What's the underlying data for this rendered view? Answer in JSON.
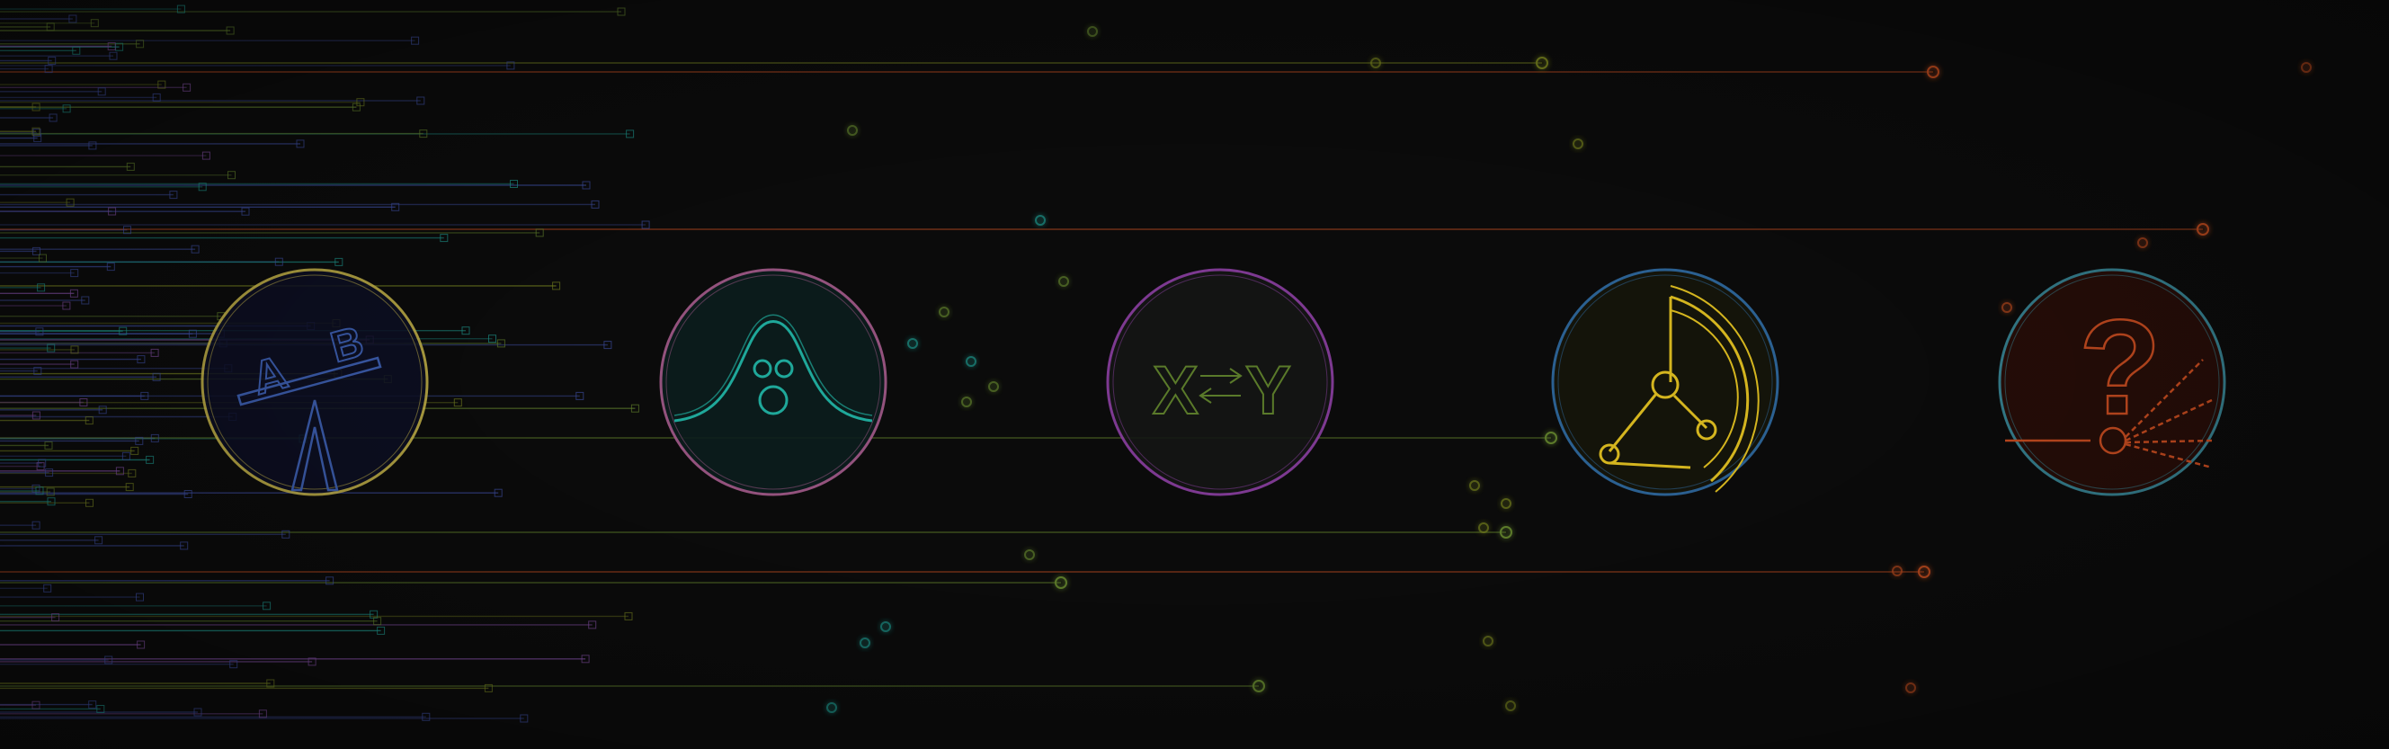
{
  "palette": {
    "background": "#0b0b0b",
    "blue": "#3b4a9a",
    "teal": "#1c8f86",
    "green": "#5c7a2a",
    "olive": "#6f7a1f",
    "yellow": "#c9b21d",
    "orange": "#b3471f",
    "purple": "#7a4a9a",
    "pink": "#a25a8a"
  },
  "emblems": [
    {
      "name": "ab-test-emblem",
      "icon": "seesaw-ab-icon",
      "letters": [
        "A",
        "B"
      ],
      "ring": "#c9b74a",
      "fill": "#0d0f24",
      "stroke": "#2f4a8f"
    },
    {
      "name": "distribution-emblem",
      "icon": "bell-curve-icon",
      "ring": "#a25a8a",
      "fill": "#0c1d1d",
      "stroke": "#1fa89a"
    },
    {
      "name": "xy-relationship-emblem",
      "icon": "x-arrows-y-icon",
      "letters": [
        "X",
        "Y"
      ],
      "ring": "#8a3fa0",
      "fill": "#141614",
      "stroke": "#4f6a2a"
    },
    {
      "name": "radar-emblem",
      "icon": "radar-sweep-icon",
      "ring": "#2f6aa0",
      "fill": "#15150a",
      "stroke": "#d4b51f"
    },
    {
      "name": "mystery-emblem",
      "icon": "question-mark-icon",
      "letters": [
        "?"
      ],
      "ring": "#3a8a9a",
      "fill": "#2a0e08",
      "stroke": "#c24a1f"
    }
  ]
}
